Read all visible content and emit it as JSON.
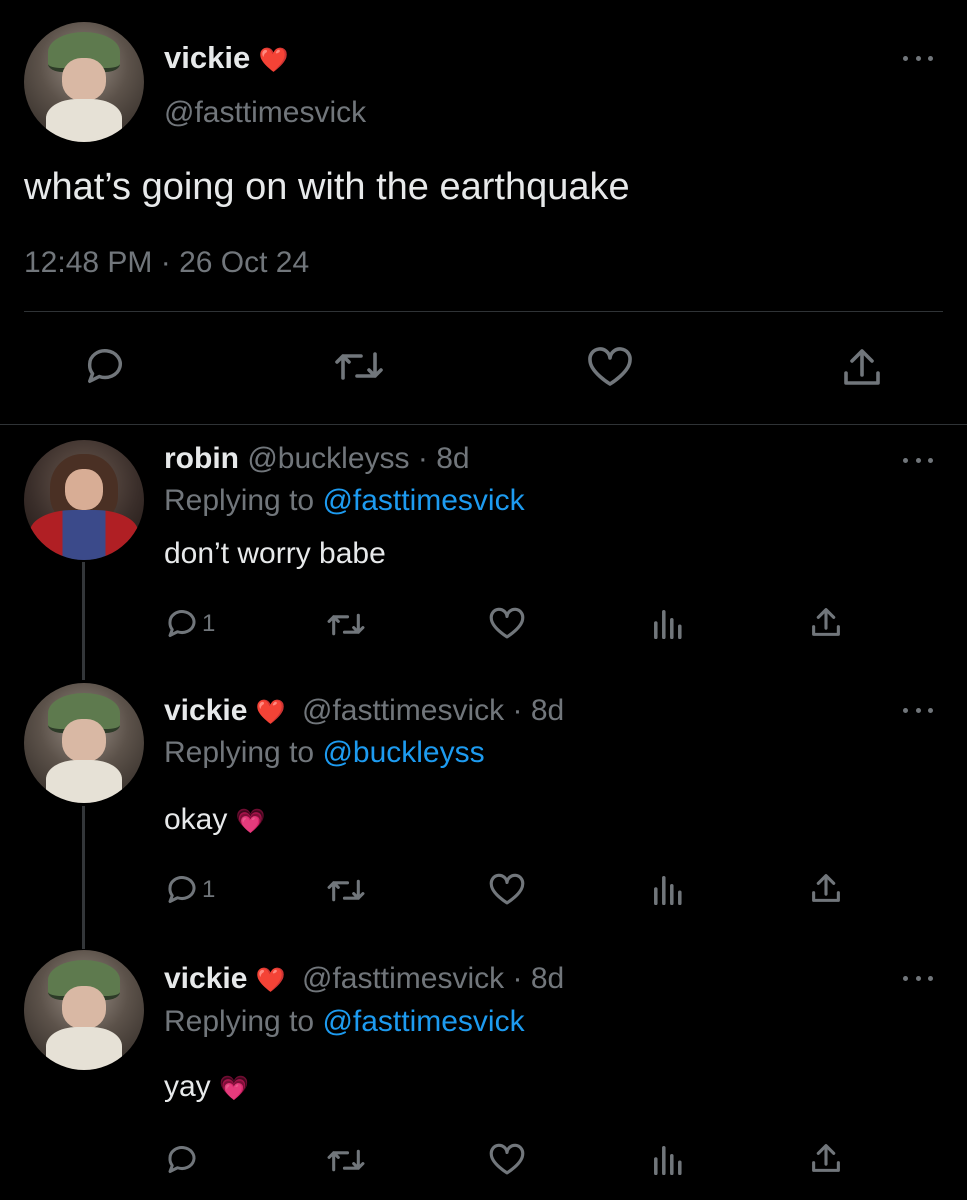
{
  "main_tweet": {
    "display_name": "vickie",
    "name_emoji": "❤️",
    "handle": "@fasttimesvick",
    "text": "what’s going on with the earthquake",
    "timestamp": "12:48 PM · 26 Oct 24"
  },
  "replies": [
    {
      "display_name": "robin",
      "handle": "@buckleyss",
      "age": "· 8d",
      "replying_prefix": "Replying to",
      "replying_to": "@fasttimesvick",
      "text": "don’t worry babe",
      "reply_count": "1"
    },
    {
      "display_name": "vickie",
      "name_emoji": "❤️",
      "handle": "@fasttimesvick",
      "age": "· 8d",
      "replying_prefix": "Replying to",
      "replying_to": "@buckleyss",
      "text": "okay",
      "text_emoji": "💗",
      "reply_count": "1"
    },
    {
      "display_name": "vickie",
      "name_emoji": "❤️",
      "handle": "@fasttimesvick",
      "age": "· 8d",
      "replying_prefix": "Replying to",
      "replying_to": "@fasttimesvick",
      "text": "yay",
      "text_emoji": "💗"
    }
  ],
  "icons": [
    "reply-icon",
    "retweet-icon",
    "like-icon",
    "views-icon",
    "share-icon",
    "more-icon"
  ],
  "colors": {
    "background": "#000000",
    "text": "#e7e9ea",
    "muted": "#71767b",
    "link": "#1d9bf0",
    "emoji_heart": "#f91880"
  }
}
